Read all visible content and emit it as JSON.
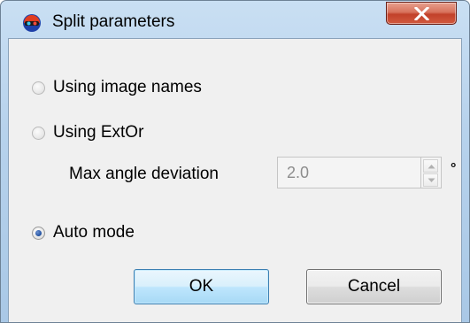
{
  "window": {
    "title": "Split parameters",
    "close_symbol": "X"
  },
  "options": [
    {
      "label": "Using image names",
      "selected": false
    },
    {
      "label": "Using ExtOr",
      "selected": false
    },
    {
      "label": "Auto mode",
      "selected": true
    }
  ],
  "angle": {
    "label": "Max angle deviation",
    "value": "2.0",
    "unit": "°",
    "enabled": false
  },
  "buttons": {
    "ok_label": "OK",
    "cancel_label": "Cancel"
  },
  "icons": {
    "app": "3d-glasses-icon",
    "close": "close-icon",
    "spin_up": "chevron-up-icon",
    "spin_down": "chevron-down-icon"
  },
  "colors": {
    "title_bar": "#b7d2ec",
    "close_button": "#c2412a",
    "dialog_background": "#f0f0f0",
    "default_button_border": "#3c7fb1",
    "radio_dot": "#1f4f9e"
  }
}
